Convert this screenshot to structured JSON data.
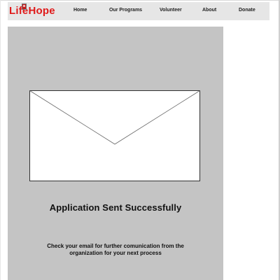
{
  "navbar": {
    "logo": "LifeHope",
    "links": [
      "Home",
      "Our Programs",
      "Volunteer",
      "About",
      "Donate"
    ]
  },
  "main": {
    "title": "Application Sent Successfully",
    "message": "Check your email for further comunication from the organization for your next process"
  },
  "colors": {
    "brand": "#e01b1b",
    "navbar_bg": "#e6e6e6",
    "panel_bg": "#c4c4c4"
  },
  "icons": {
    "envelope": "envelope-icon"
  }
}
